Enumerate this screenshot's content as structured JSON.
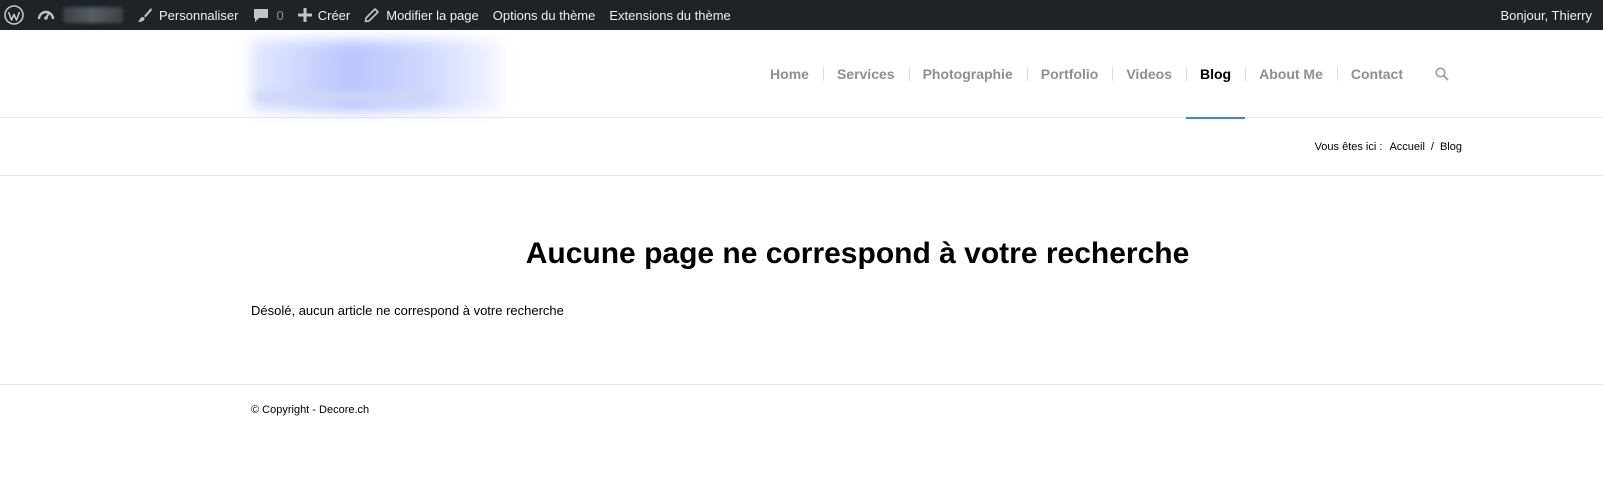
{
  "admin_bar": {
    "customize_label": "Personnaliser",
    "comments_count": "0",
    "new_label": "Créer",
    "edit_page_label": "Modifier la page",
    "theme_options_label": "Options du thème",
    "theme_extensions_label": "Extensions du thème",
    "greeting": "Bonjour, Thierry"
  },
  "nav": {
    "items": [
      {
        "label": "Home"
      },
      {
        "label": "Services"
      },
      {
        "label": "Photographie"
      },
      {
        "label": "Portfolio"
      },
      {
        "label": "Videos"
      },
      {
        "label": "Blog"
      },
      {
        "label": "About Me"
      },
      {
        "label": "Contact"
      }
    ],
    "active": "Blog"
  },
  "breadcrumb": {
    "prefix": "Vous êtes ici :",
    "home": "Accueil",
    "separator": "/",
    "current": "Blog"
  },
  "main": {
    "title": "Aucune page ne correspond à votre recherche",
    "message": "Désolé, aucun article ne correspond à votre recherche"
  },
  "footer": {
    "copyright": "© Copyright - Decore.ch"
  },
  "colors": {
    "admin_bar_bg": "#1d2327",
    "nav_active_underline": "#3c80f6",
    "nav_text": "#8f8f8f"
  }
}
